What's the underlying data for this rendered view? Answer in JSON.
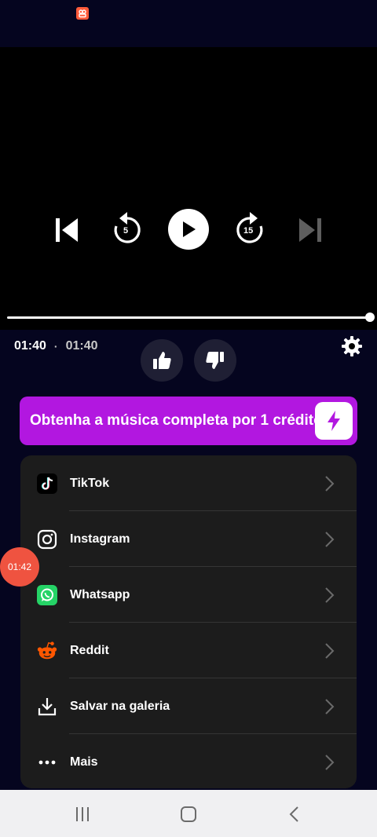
{
  "player": {
    "time_elapsed": "01:40",
    "time_separator": "·",
    "time_total": "01:40",
    "progress": 1.0,
    "rewind_seconds": "5",
    "forward_seconds": "15"
  },
  "banner": {
    "text": "Obtenha a música completa por 1 crédito"
  },
  "share": {
    "items": [
      {
        "label": "TikTok",
        "icon": "tiktok-icon"
      },
      {
        "label": "Instagram",
        "icon": "instagram-icon"
      },
      {
        "label": "Whatsapp",
        "icon": "whatsapp-icon"
      },
      {
        "label": "Reddit",
        "icon": "reddit-icon"
      },
      {
        "label": "Salvar na galeria",
        "icon": "download-icon"
      },
      {
        "label": "Mais",
        "icon": "more-dots-icon"
      }
    ]
  },
  "timer_badge": {
    "text": "01:42"
  },
  "colors": {
    "background": "#05051f",
    "accent": "#b217e0",
    "card": "#1c1c1c",
    "timer": "#ef5340"
  }
}
